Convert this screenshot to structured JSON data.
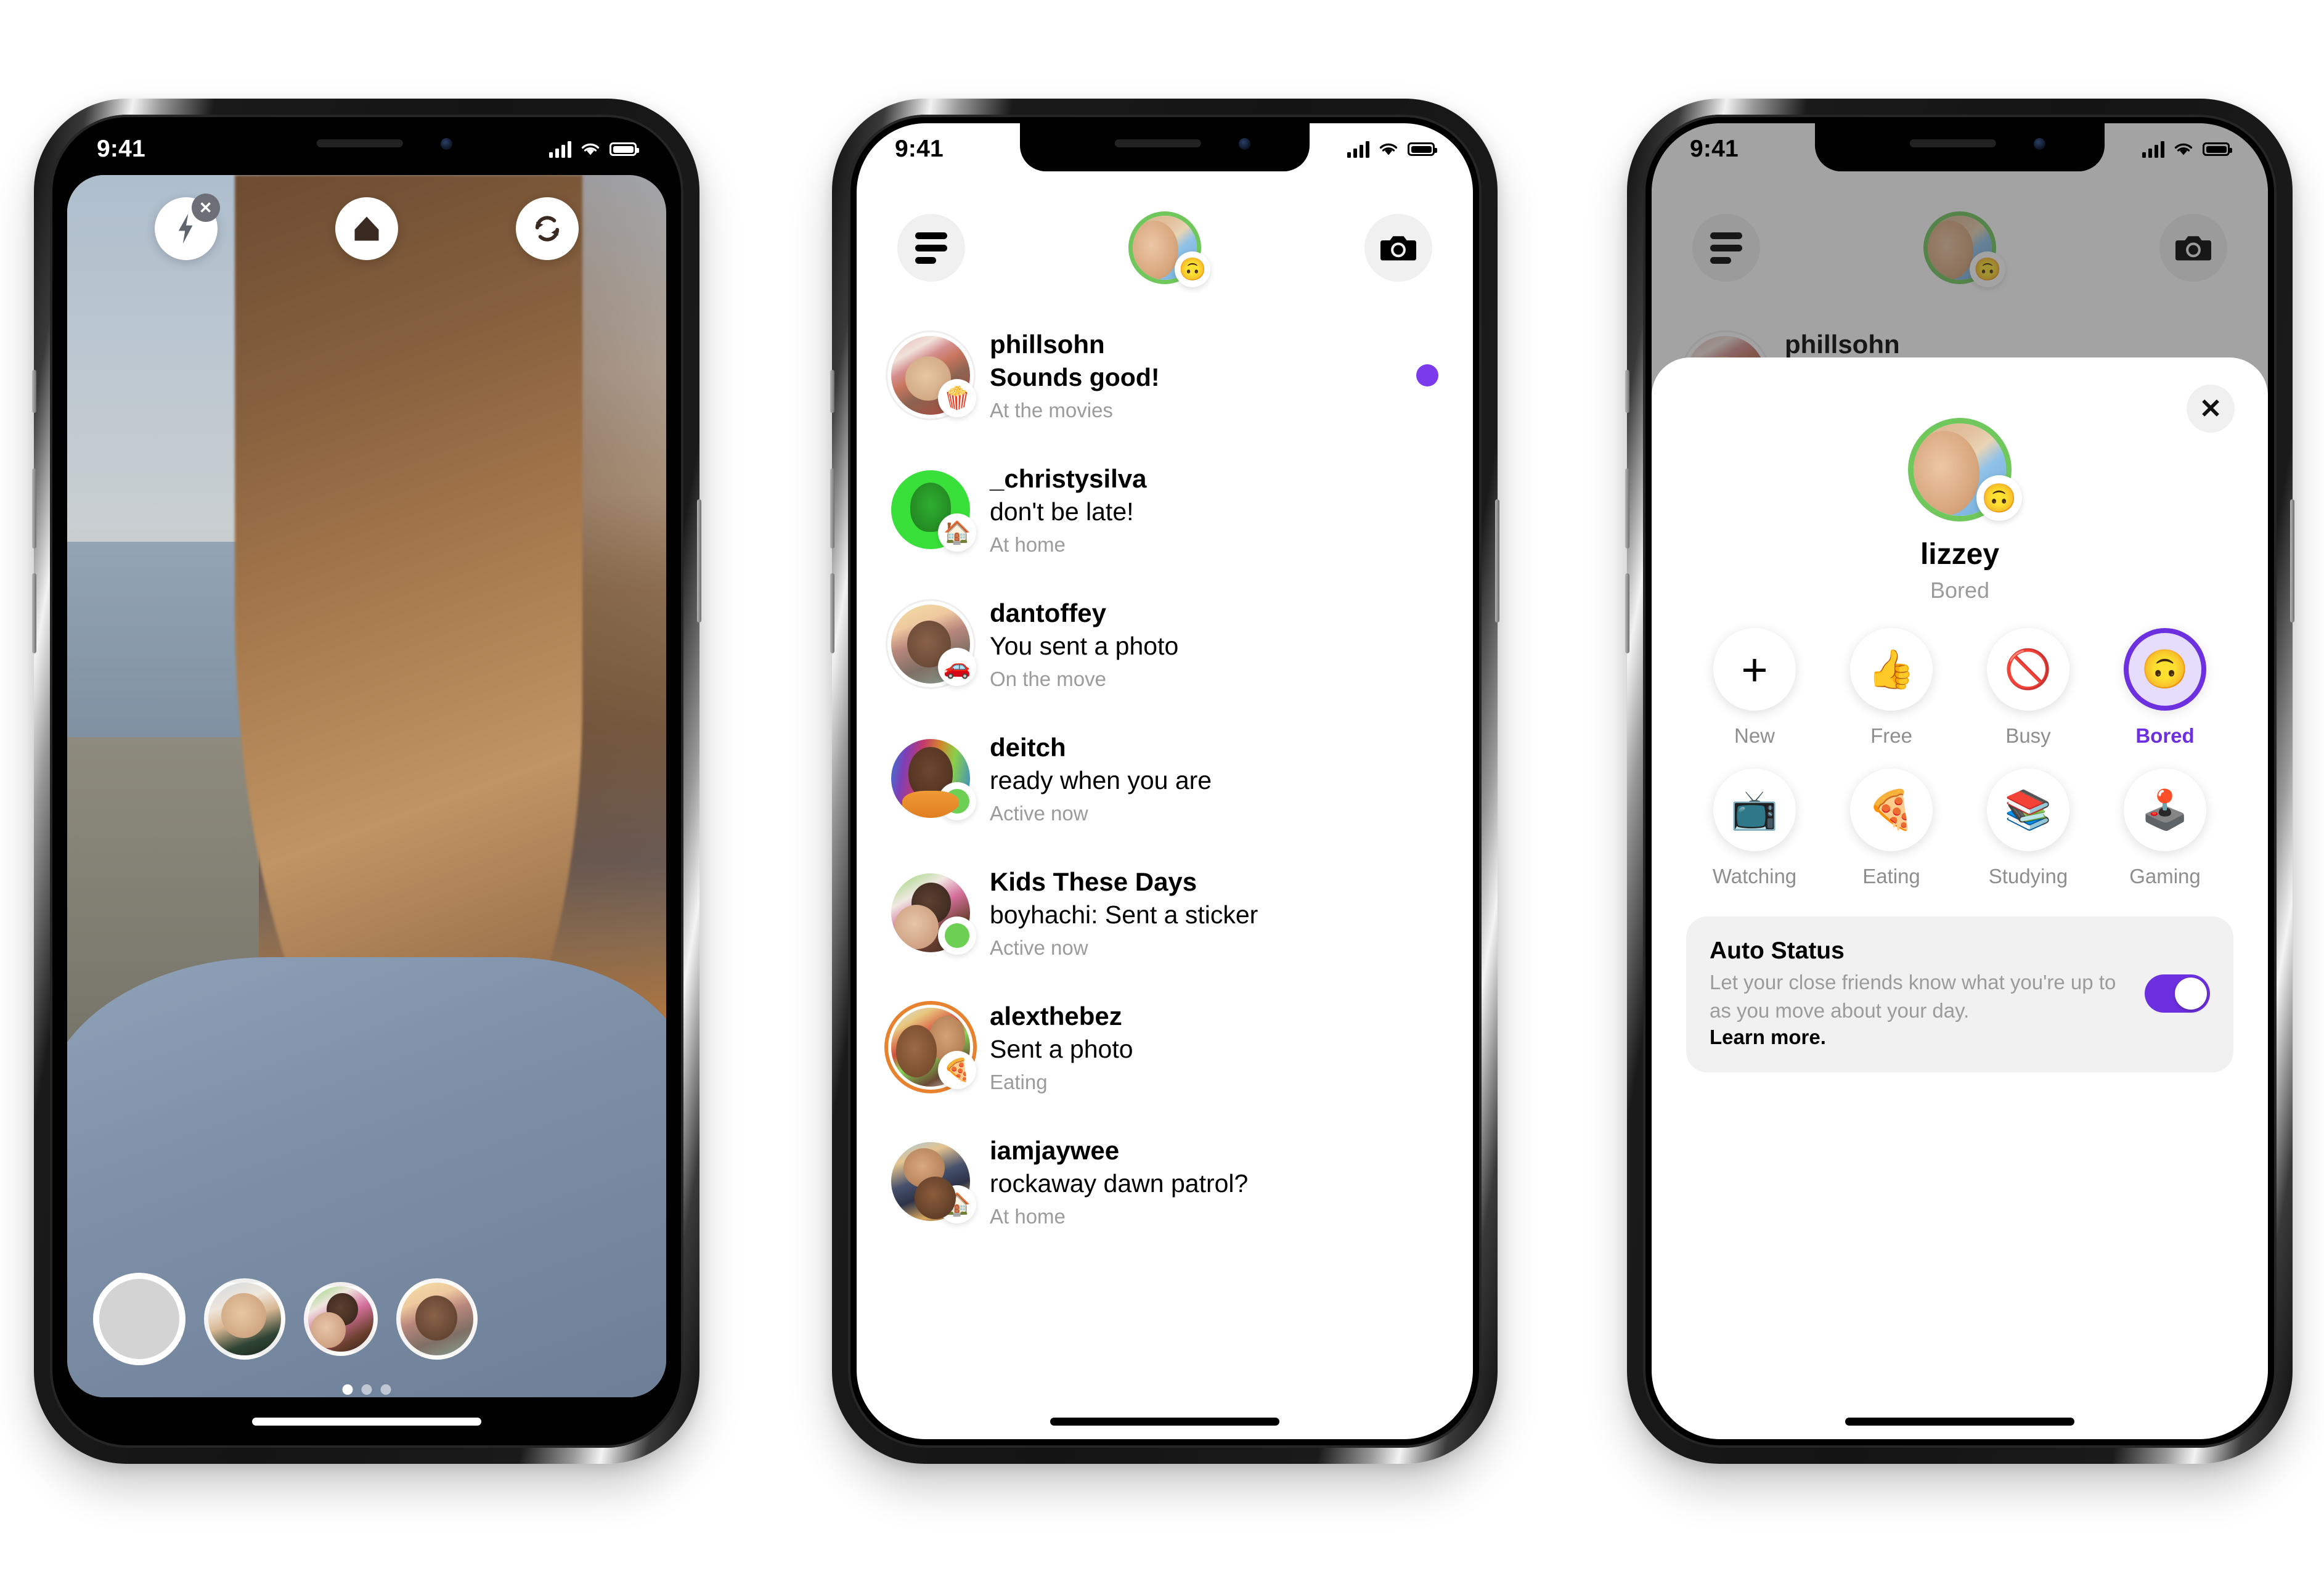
{
  "statusbar": {
    "time": "9:41",
    "cellular": "signal-bars",
    "wifi": "wifi-icon",
    "battery": "battery-icon"
  },
  "phone1": {
    "name": "camera-screen",
    "controls": {
      "flash_off": "flash-off-icon",
      "home": "home-icon",
      "flip_camera": "flip-camera-icon"
    },
    "shutter_label": "shutter-button",
    "effects": [
      {
        "name": "effect-1"
      },
      {
        "name": "effect-2"
      },
      {
        "name": "effect-3"
      }
    ],
    "pager": {
      "pages": 3,
      "active": 1
    }
  },
  "phone2": {
    "name": "direct-inbox",
    "header": {
      "menu_icon": "hamburger-icon",
      "camera_icon": "camera-icon",
      "me": {
        "username": "lizzey",
        "status_emoji": "🙃",
        "ring_color": "#70c75c"
      }
    },
    "threads": [
      {
        "name": "phillsohn",
        "message": "Sounds good!",
        "bold": true,
        "sub": "At the movies",
        "badge": "🍿",
        "badge_type": "emoji",
        "unread": true,
        "ring": "white",
        "avatar": "im-phill"
      },
      {
        "name": "_christysilva",
        "message": "don't be late!",
        "bold": false,
        "sub": "At home",
        "badge": "🏠",
        "badge_type": "emoji",
        "unread": false,
        "ring": "none",
        "avatar": "im-christy"
      },
      {
        "name": "dantoffey",
        "message": "You sent a photo",
        "bold": false,
        "sub": "On the move",
        "badge": "🚗",
        "badge_type": "emoji",
        "unread": false,
        "ring": "white",
        "avatar": "im-dan"
      },
      {
        "name": "deitch",
        "message": "ready when you are",
        "bold": false,
        "sub": "Active now",
        "badge": "",
        "badge_type": "green",
        "unread": false,
        "ring": "none",
        "avatar": "im-deitch"
      },
      {
        "name": "Kids These Days",
        "message": "boyhachi: Sent a sticker",
        "bold": false,
        "sub": "Active now",
        "badge": "",
        "badge_type": "green",
        "unread": false,
        "ring": "none",
        "avatar": "im-kids"
      },
      {
        "name": "alexthebez",
        "message": "Sent a photo",
        "bold": false,
        "sub": "Eating",
        "badge": "🍕",
        "badge_type": "emoji",
        "unread": false,
        "ring": "orange",
        "avatar": "im-alex"
      },
      {
        "name": "iamjaywee",
        "message": "rockaway dawn patrol?",
        "bold": false,
        "sub": "At home",
        "badge": "🏠",
        "badge_type": "emoji",
        "unread": false,
        "ring": "none",
        "avatar": "im-jay"
      }
    ]
  },
  "phone3": {
    "name": "status-picker-sheet",
    "close_icon": "close-icon",
    "me": {
      "username": "lizzey",
      "status": "Bored",
      "status_emoji": "🙃",
      "ring_color": "#70c75c"
    },
    "statuses": [
      {
        "label": "New",
        "emoji": "+",
        "selected": false,
        "icon": "plus-icon"
      },
      {
        "label": "Free",
        "emoji": "👍",
        "selected": false,
        "icon": "thumbs-up-icon"
      },
      {
        "label": "Busy",
        "emoji": "🚫",
        "selected": false,
        "icon": "no-entry-icon"
      },
      {
        "label": "Bored",
        "emoji": "🙃",
        "selected": true,
        "icon": "upside-down-face-icon"
      },
      {
        "label": "Watching",
        "emoji": "📺",
        "selected": false,
        "icon": "television-icon"
      },
      {
        "label": "Eating",
        "emoji": "🍕",
        "selected": false,
        "icon": "pizza-icon"
      },
      {
        "label": "Studying",
        "emoji": "📚",
        "selected": false,
        "icon": "books-icon"
      },
      {
        "label": "Gaming",
        "emoji": "🕹️",
        "selected": false,
        "icon": "joystick-icon"
      }
    ],
    "auto_status": {
      "title": "Auto Status",
      "description": "Let your close friends know what you're up to as you move about your day.",
      "link": "Learn more.",
      "toggle_on": true
    }
  },
  "colors": {
    "accent_purple": "#6d30e0",
    "unread_purple": "#7c3aed",
    "active_green": "#6ecf55",
    "ring_green": "#70c75c",
    "story_ring_orange": "#e8822f",
    "muted_gray": "#9b9b9b"
  }
}
